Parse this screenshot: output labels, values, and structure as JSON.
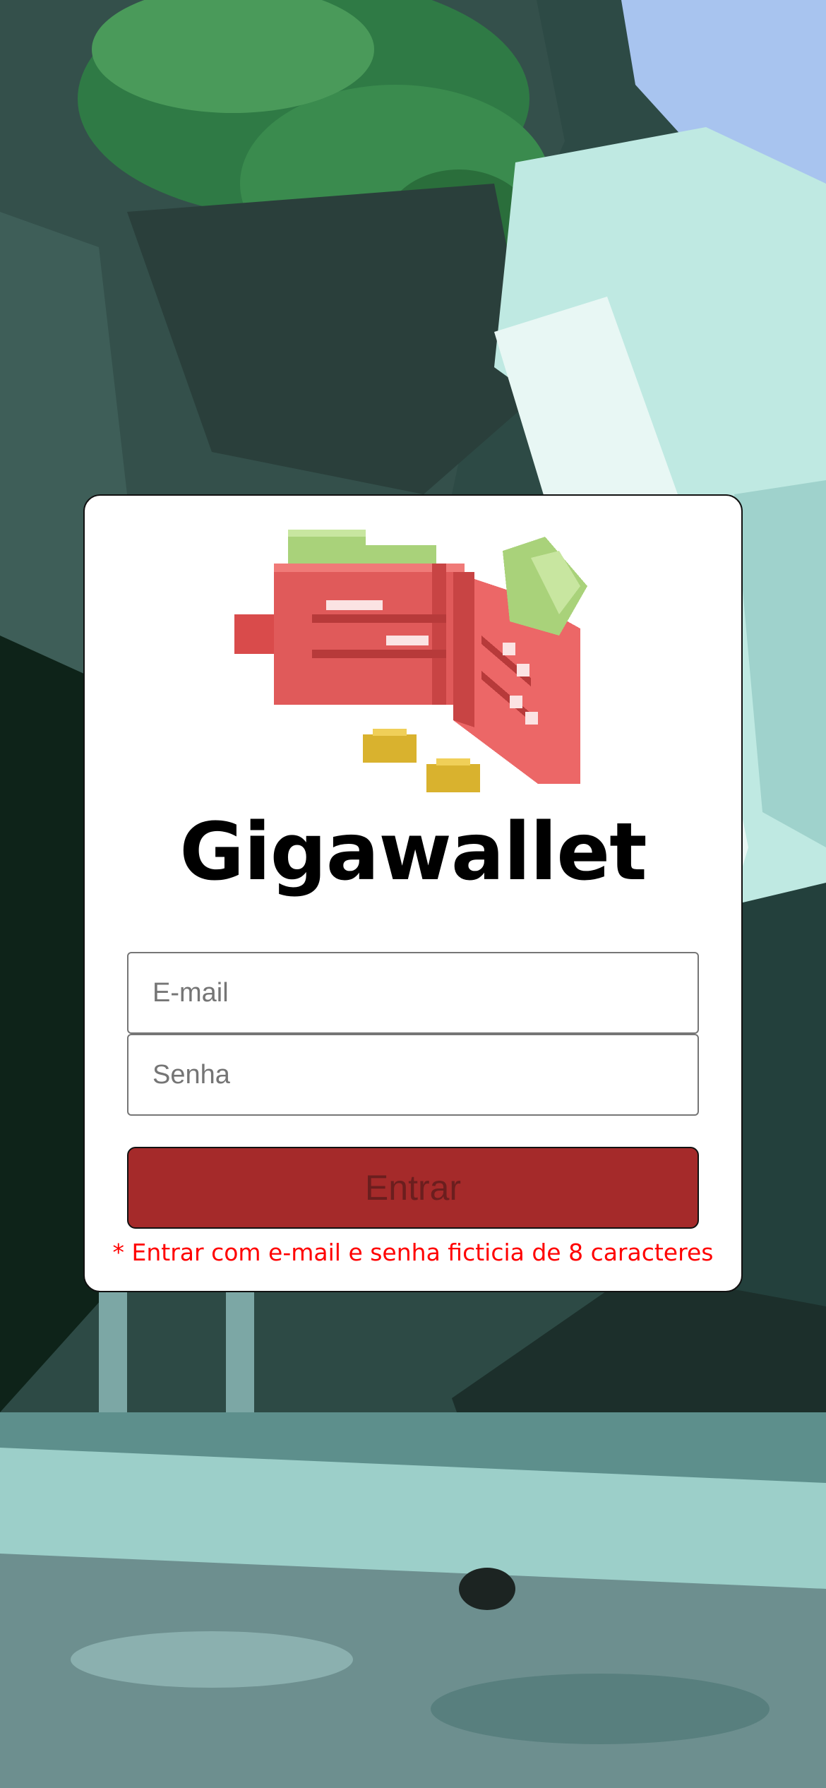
{
  "app": {
    "title": "Gigawallet"
  },
  "login": {
    "email_placeholder": "E-mail",
    "email_value": "",
    "password_placeholder": "Senha",
    "password_value": "",
    "submit_label": "Entrar",
    "hint": "* Entrar com e-mail e senha ficticia de 8 caracteres"
  },
  "colors": {
    "button_bg": "#a52a2a",
    "hint_text": "#ff0000",
    "card_bg": "#ffffff"
  },
  "icons": {
    "logo": "pixel-wallet-icon",
    "background": "pixel-waterfall-scene"
  }
}
